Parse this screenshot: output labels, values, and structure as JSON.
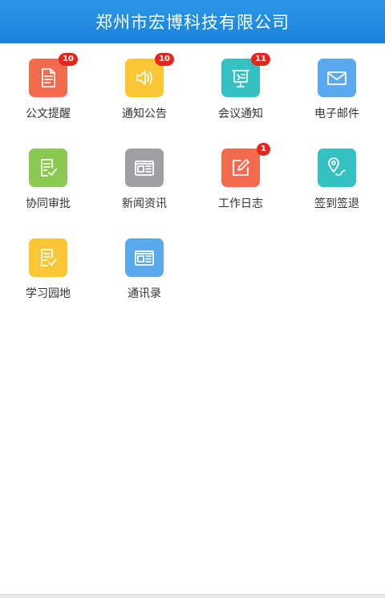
{
  "header": {
    "title": "郑州市宏博科技有限公司"
  },
  "apps": [
    {
      "label": "公文提醒",
      "badge": "10",
      "color": "#f46a4e",
      "icon": "document-icon"
    },
    {
      "label": "通知公告",
      "badge": "10",
      "color": "#fbc636",
      "icon": "speaker-icon"
    },
    {
      "label": "会议通知",
      "badge": "11",
      "color": "#35c0c2",
      "icon": "meeting-board-icon"
    },
    {
      "label": "电子邮件",
      "badge": "",
      "color": "#5aa9ef",
      "icon": "mail-icon"
    },
    {
      "label": "协同审批",
      "badge": "",
      "color": "#8bc84f",
      "icon": "approval-check-icon"
    },
    {
      "label": "新闻资讯",
      "badge": "",
      "color": "#9ea0a4",
      "icon": "newspaper-icon"
    },
    {
      "label": "工作日志",
      "badge": "1",
      "color": "#f46a4e",
      "icon": "edit-log-icon"
    },
    {
      "label": "签到签退",
      "badge": "",
      "color": "#35c0c2",
      "icon": "location-pin-icon"
    },
    {
      "label": "学习园地",
      "badge": "",
      "color": "#fbc636",
      "icon": "study-check-icon"
    },
    {
      "label": "通讯录",
      "badge": "",
      "color": "#5aa9ef",
      "icon": "contacts-news-icon"
    }
  ]
}
